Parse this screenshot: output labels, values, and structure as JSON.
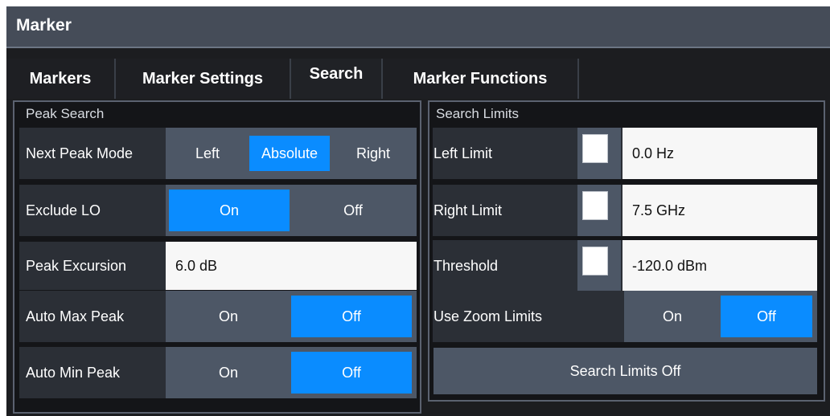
{
  "window": {
    "title": "Marker"
  },
  "tabs": [
    {
      "label": "Markers"
    },
    {
      "label": "Marker Settings"
    },
    {
      "label": "Search"
    },
    {
      "label": "Marker Functions"
    }
  ],
  "peak_search": {
    "group_label": "Peak Search",
    "next_peak_mode": {
      "label": "Next Peak Mode",
      "options": [
        "Left",
        "Absolute",
        "Right"
      ],
      "selected": "Absolute"
    },
    "exclude_lo": {
      "label": "Exclude LO",
      "on": "On",
      "off": "Off",
      "selected": "On"
    },
    "peak_excursion": {
      "label": "Peak Excursion",
      "value": "6.0 dB"
    },
    "auto_max_peak": {
      "label": "Auto Max Peak",
      "on": "On",
      "off": "Off",
      "selected": "Off"
    },
    "auto_min_peak": {
      "label": "Auto Min Peak",
      "on": "On",
      "off": "Off",
      "selected": "Off"
    }
  },
  "search_limits": {
    "group_label": "Search Limits",
    "left_limit": {
      "label": "Left Limit",
      "value": "0.0 Hz",
      "checked": false
    },
    "right_limit": {
      "label": "Right Limit",
      "value": "7.5 GHz",
      "checked": false
    },
    "threshold": {
      "label": "Threshold",
      "value": "-120.0 dBm",
      "checked": false
    },
    "use_zoom_limits": {
      "label": "Use Zoom Limits",
      "on": "On",
      "off": "Off",
      "selected": "Off"
    },
    "search_limits_off": {
      "label": "Search Limits Off"
    }
  },
  "colors": {
    "selected": "#0a8cff",
    "control": "#4d5766",
    "background": "#1c1d20"
  }
}
